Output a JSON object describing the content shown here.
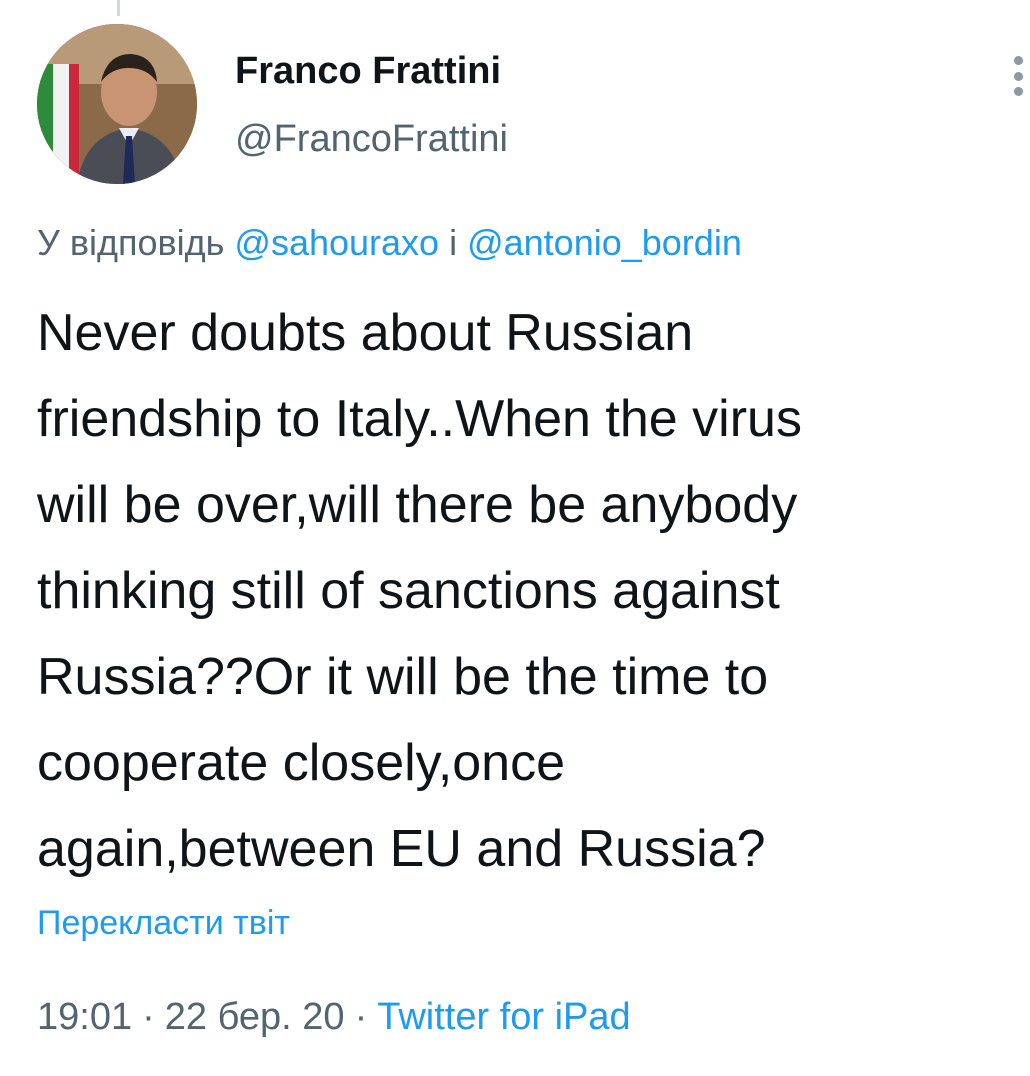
{
  "tweet": {
    "author": {
      "name": "Franco Frattini",
      "handle": "@FrancoFrattini"
    },
    "reply": {
      "prefix": "У відповідь ",
      "mention_1": "@sahouraxo",
      "joiner": " і ",
      "mention_2": "@antonio_bordin"
    },
    "text_lines": [
      "Never doubts about Russian",
      "friendship to Italy..When the virus",
      "will be over,will there be anybody",
      "thinking still of sanctions against",
      "Russia??Or it will be the time to",
      "cooperate closely,once",
      "again,between EU and Russia?"
    ],
    "translate_label": "Перекласти твіт",
    "time": "19:01",
    "date": "22 бер. 20",
    "separator": "·",
    "source": "Twitter for iPad"
  },
  "icons": {
    "more": "more-vertical-icon"
  },
  "colors": {
    "link": "#1d9bf0",
    "secondary_text": "#536471",
    "primary_text": "#0f1419"
  }
}
